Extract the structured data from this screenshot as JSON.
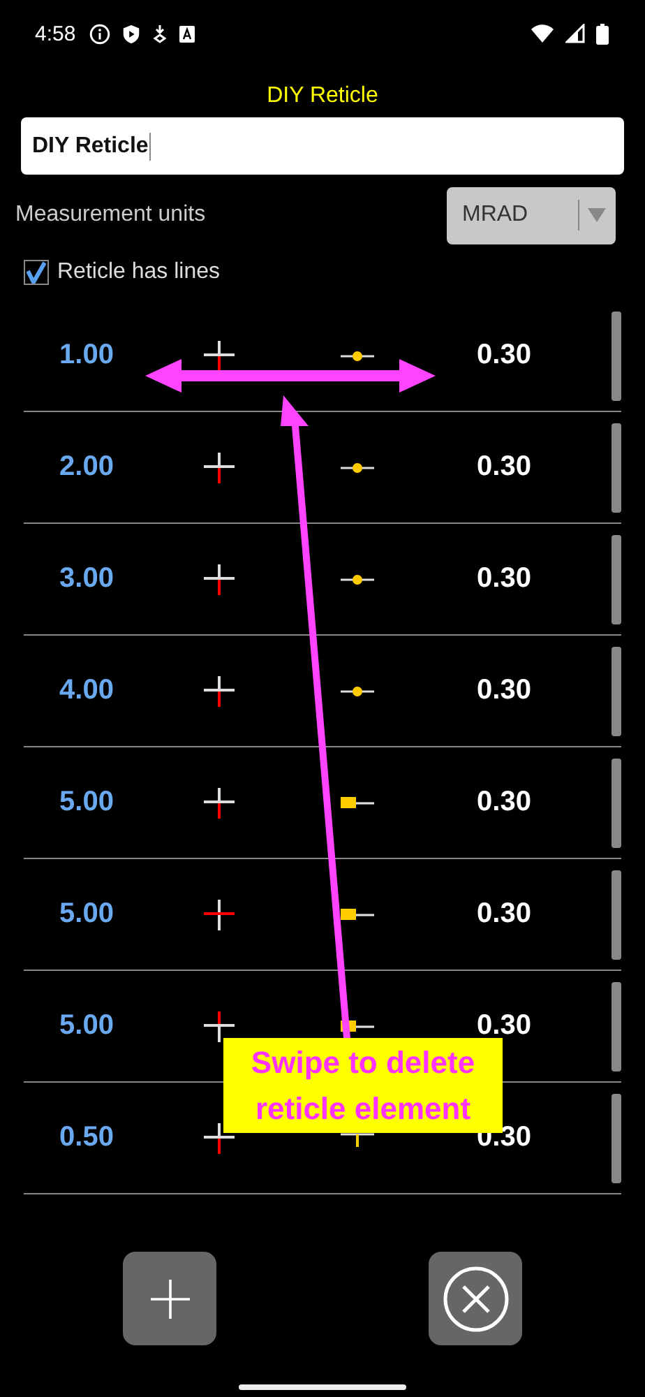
{
  "status_bar": {
    "time": "4:58"
  },
  "title": "DIY Reticle",
  "name_field": {
    "value": "DIY Reticle"
  },
  "units": {
    "label": "Measurement units",
    "value": "MRAD"
  },
  "has_lines": {
    "label": "Reticle has lines",
    "checked": true
  },
  "rows": [
    {
      "value": "1.00",
      "cross": {
        "kind": "bottom"
      },
      "marker": {
        "kind": "dot"
      },
      "size": "0.30"
    },
    {
      "value": "2.00",
      "cross": {
        "kind": "bottom"
      },
      "marker": {
        "kind": "dot"
      },
      "size": "0.30"
    },
    {
      "value": "3.00",
      "cross": {
        "kind": "bottom"
      },
      "marker": {
        "kind": "dot"
      },
      "size": "0.30"
    },
    {
      "value": "4.00",
      "cross": {
        "kind": "bottom"
      },
      "marker": {
        "kind": "dot"
      },
      "size": "0.30"
    },
    {
      "value": "5.00",
      "cross": {
        "kind": "bottom"
      },
      "marker": {
        "kind": "square"
      },
      "size": "0.30"
    },
    {
      "value": "5.00",
      "cross": {
        "kind": "horizontal"
      },
      "marker": {
        "kind": "square"
      },
      "size": "0.30"
    },
    {
      "value": "5.00",
      "cross": {
        "kind": "top"
      },
      "marker": {
        "kind": "square"
      },
      "size": "0.30"
    },
    {
      "value": "0.50",
      "cross": {
        "kind": "bottom"
      },
      "marker": {
        "kind": "tick"
      },
      "size": "0.30"
    }
  ],
  "annotation": {
    "text": "Swipe to delete reticle element"
  }
}
